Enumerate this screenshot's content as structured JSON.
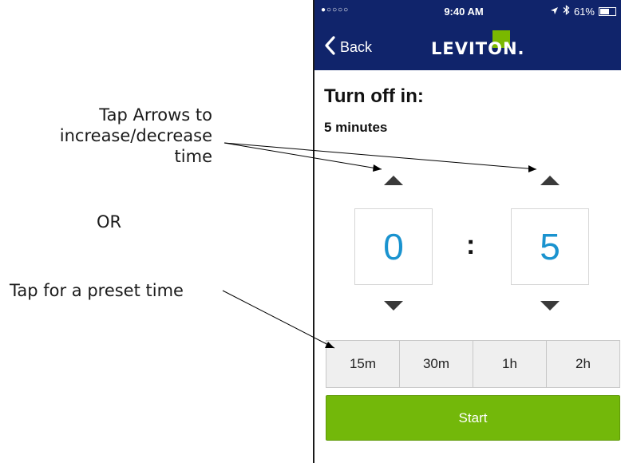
{
  "annotations": {
    "arrows_line1": "Tap Arrows to",
    "arrows_line2": "increase/decrease",
    "arrows_line3": "time",
    "or": "OR",
    "preset": "Tap for a preset time"
  },
  "statusbar": {
    "signal": "●○○○○",
    "time": "9:40 AM",
    "battery": "61%",
    "battery_level": 0.61
  },
  "navbar": {
    "back_label": "Back",
    "logo": "LEVITON."
  },
  "timer": {
    "heading": "Turn off in:",
    "summary": "5 minutes",
    "hours": "0",
    "separator": ":",
    "minutes": "5"
  },
  "presets": [
    "15m",
    "30m",
    "1h",
    "2h"
  ],
  "start_label": "Start",
  "colors": {
    "navbar": "#10246b",
    "accent_green": "#73b80a",
    "digit_blue": "#1a93cf"
  }
}
